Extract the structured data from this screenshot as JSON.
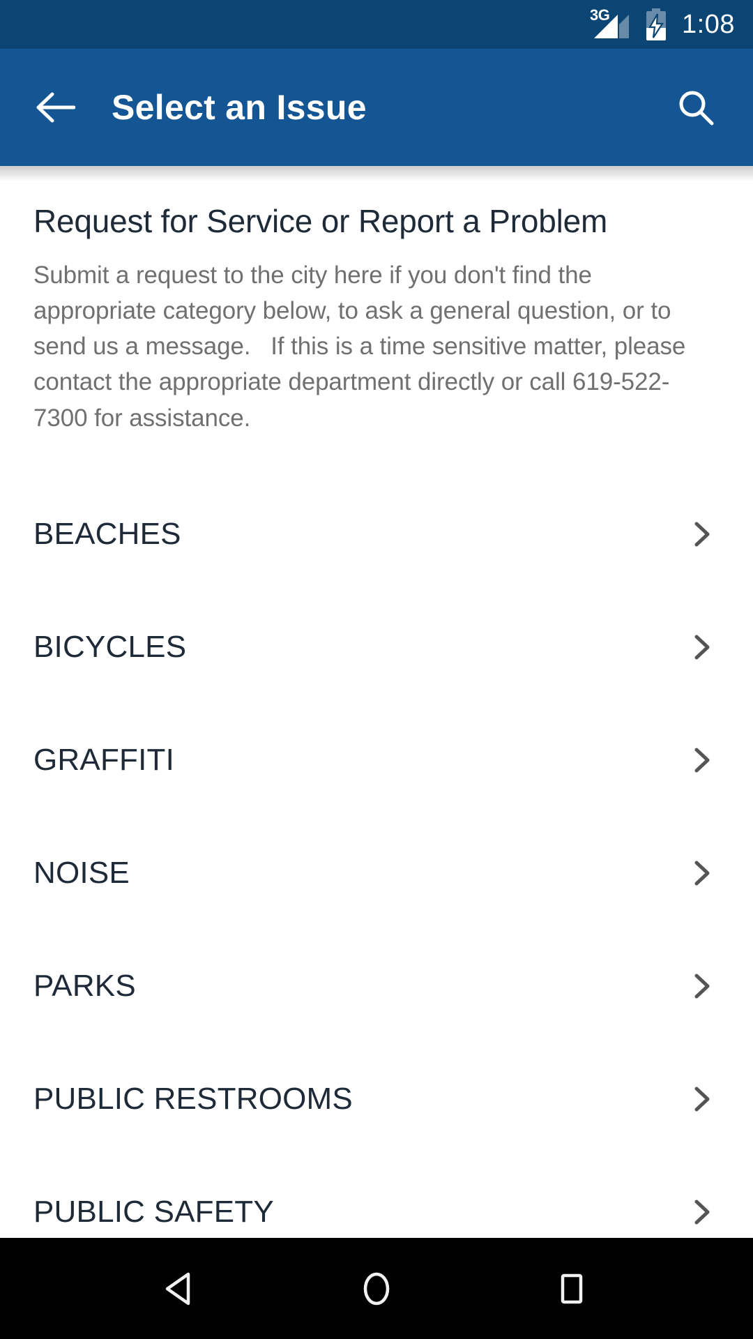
{
  "status_bar": {
    "network_label": "3G",
    "battery_state": "charging",
    "time": "1:08",
    "background_color": "#0b4574"
  },
  "app_bar": {
    "back_label": "back-arrow",
    "title": "Select an Issue",
    "search_label": "search",
    "background_color": "#145693"
  },
  "intro": {
    "title": "Request for Service or Report a Problem",
    "body": "Submit a request to the city here if you don't find the appropriate category below, to ask a general question, or to send us a message.   If this is a time sensitive matter, please contact the appropriate department directly or call 619-522-7300 for assistance."
  },
  "issues": [
    {
      "label": "BEACHES"
    },
    {
      "label": "BICYCLES"
    },
    {
      "label": "GRAFFITI"
    },
    {
      "label": "NOISE"
    },
    {
      "label": "PARKS"
    },
    {
      "label": "PUBLIC RESTROOMS"
    },
    {
      "label": "PUBLIC SAFETY"
    }
  ],
  "nav_bar": {
    "back": "back-triangle",
    "home": "home-circle",
    "recents": "recents-square"
  },
  "colors": {
    "status_bar": "#0b4574",
    "app_bar": "#145693",
    "text_primary": "#1e2a38",
    "text_secondary": "#707070",
    "chevron": "#555555",
    "nav_bar": "#000000"
  }
}
